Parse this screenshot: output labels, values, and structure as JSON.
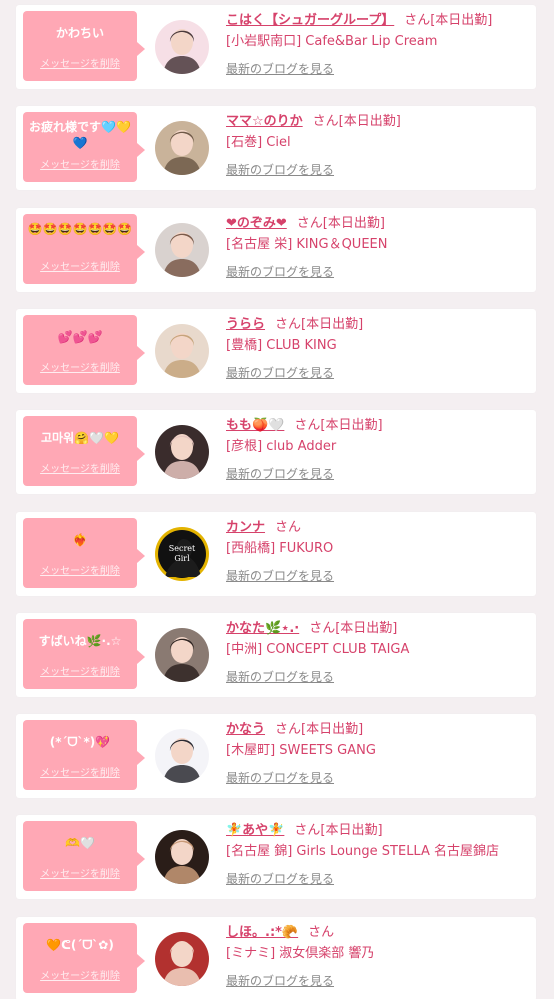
{
  "colors": {
    "page_bg": "#f4eff1",
    "bubble_pink": "#ffa8b5",
    "accent_pink": "#d6426b",
    "link_gray": "#8a8a8a"
  },
  "labels": {
    "delete_message": "メッセージを削除",
    "view_blog": "最新のブログを見る"
  },
  "entries": [
    {
      "message": "かわちい",
      "name": "こはく【シュガーグループ】",
      "status": "さん[本日出勤]",
      "shop": "[小岩駅南口] Cafe&Bar Lip Cream",
      "avatar_icon": "portrait-girl-headphones-icon",
      "avatar_bg": "#f6dfe6",
      "avatar_fg": "#4a3a3c"
    },
    {
      "message": "お疲れ様です🩵💛💙",
      "name": "ママ☆のりか",
      "status": "さん[本日出勤]",
      "shop": "[石巻] Ciel",
      "avatar_icon": "portrait-group-icon",
      "avatar_bg": "#c9b39a",
      "avatar_fg": "#6f5a48"
    },
    {
      "message": "🤩🤩🤩🤩🤩🤩🤩",
      "name": "❤のぞみ❤",
      "status": "さん[本日出勤]",
      "shop": "[名古屋 栄] KING＆QUEEN",
      "avatar_icon": "portrait-girl-icon",
      "avatar_bg": "#d9d2cf",
      "avatar_fg": "#7a5a4a"
    },
    {
      "message": "💕💕💕",
      "name": "うらら",
      "status": "さん[本日出勤]",
      "shop": "[豊橋] CLUB KING",
      "avatar_icon": "portrait-blonde-icon",
      "avatar_bg": "#e8d9cc",
      "avatar_fg": "#c6a47c"
    },
    {
      "message": "고마워🤗🤍💛",
      "name": "もも🍑🤍",
      "status": "さん[本日出勤]",
      "shop": "[彦根] club Adder",
      "avatar_icon": "portrait-bow-girl-icon",
      "avatar_bg": "#3a2c2c",
      "avatar_fg": "#e7c6c0"
    },
    {
      "message": "❤️‍🔥",
      "name": "カンナ",
      "status": "さん",
      "shop": "[西船橋] FUKURO",
      "avatar_icon": "secret-girl-logo-icon",
      "avatar_bg": "#e3b300",
      "avatar_fg": "#111111",
      "avatar_text1": "Secret",
      "avatar_text2": "Girl"
    },
    {
      "message": "すばいね🌿·.☆",
      "name": "かなた🌿⋆.·",
      "status": "さん[本日出勤]",
      "shop": "[中洲] CONCEPT CLUB TAIGA",
      "avatar_icon": "portrait-dark-hair-icon",
      "avatar_bg": "#8a7a72",
      "avatar_fg": "#2f2522"
    },
    {
      "message": "(*ˊᗜˋ*)💖",
      "name": "かなう",
      "status": "さん[本日出勤]",
      "shop": "[木屋町] SWEETS GANG",
      "avatar_icon": "portrait-standing-girl-icon",
      "avatar_bg": "#f4f4f8",
      "avatar_fg": "#2b2b33"
    },
    {
      "message": "🫶🤍",
      "name": "🧚あや🧚",
      "status": "さん[本日出勤]",
      "shop": "[名古屋 錦] Girls Lounge STELLA 名古屋錦店",
      "avatar_icon": "portrait-dark-bg-icon",
      "avatar_bg": "#2a1d18",
      "avatar_fg": "#c89a78"
    },
    {
      "message": "🧡ᕦ(ˊᗜˋ✿)",
      "name": "しほ。.:*🥐",
      "status": "さん",
      "shop": "[ミナミ] 淑女倶楽部 響乃",
      "avatar_icon": "portrait-red-heart-icon",
      "avatar_bg": "#b2312f",
      "avatar_fg": "#f2d7c5"
    }
  ]
}
